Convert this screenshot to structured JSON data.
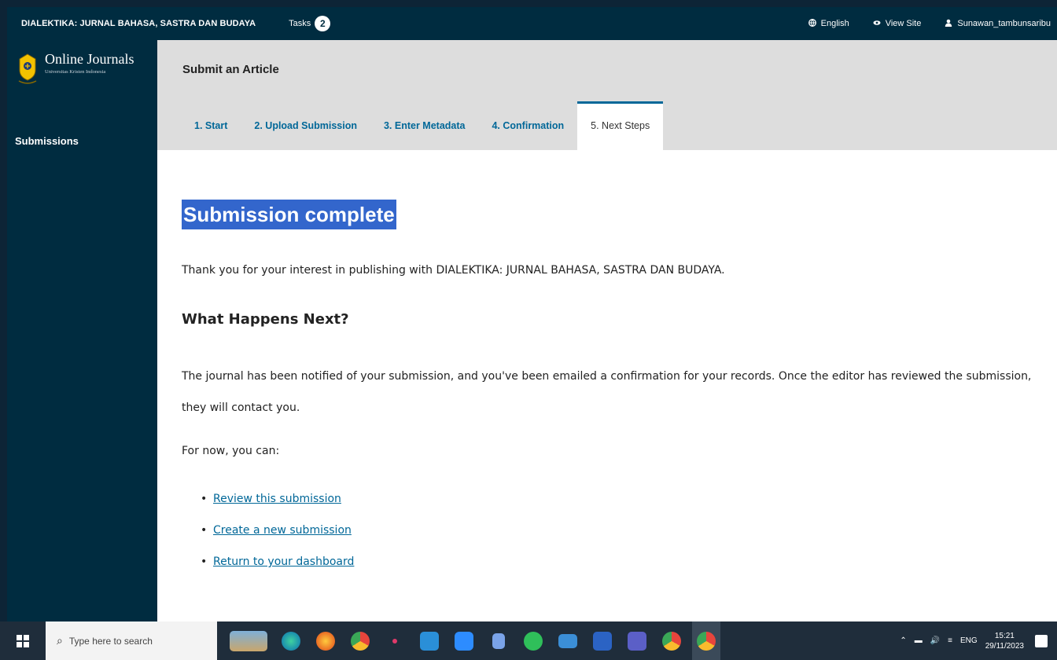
{
  "topbar": {
    "journal_name": "DIALEKTIKA: JURNAL BAHASA, SASTRA DAN BUDAYA",
    "tasks_label": "Tasks",
    "tasks_count": "2",
    "language": "English",
    "view_site": "View Site",
    "username": "Sunawan_tambunsaribu"
  },
  "sidebar": {
    "brand_title": "Online Journals",
    "brand_subtitle": "Universitas Kristen Indonesia",
    "nav_submissions": "Submissions"
  },
  "header": {
    "title": "Submit an Article",
    "tabs": [
      {
        "label": "1. Start"
      },
      {
        "label": "2. Upload Submission"
      },
      {
        "label": "3. Enter Metadata"
      },
      {
        "label": "4. Confirmation"
      },
      {
        "label": "5. Next Steps",
        "active": true
      }
    ]
  },
  "main": {
    "heading": "Submission complete",
    "thanks": "Thank you for your interest in publishing with DIALEKTIKA: JURNAL BAHASA, SASTRA DAN BUDAYA.",
    "next_heading": "What Happens Next?",
    "notified": "The journal has been notified of your submission, and you've been emailed a confirmation for your records. Once the editor has reviewed the submission, they will contact you.",
    "for_now": "For now, you can:",
    "links": [
      "Review this submission",
      "Create a new submission",
      "Return to your dashboard"
    ]
  },
  "taskbar": {
    "search_placeholder": "Type here to search",
    "language": "ENG",
    "time": "15:21",
    "date": "29/11/2023"
  },
  "colors": {
    "dark": "#002c40",
    "link": "#006798",
    "highlight": "#3366cc",
    "header_band": "#dddddd"
  }
}
